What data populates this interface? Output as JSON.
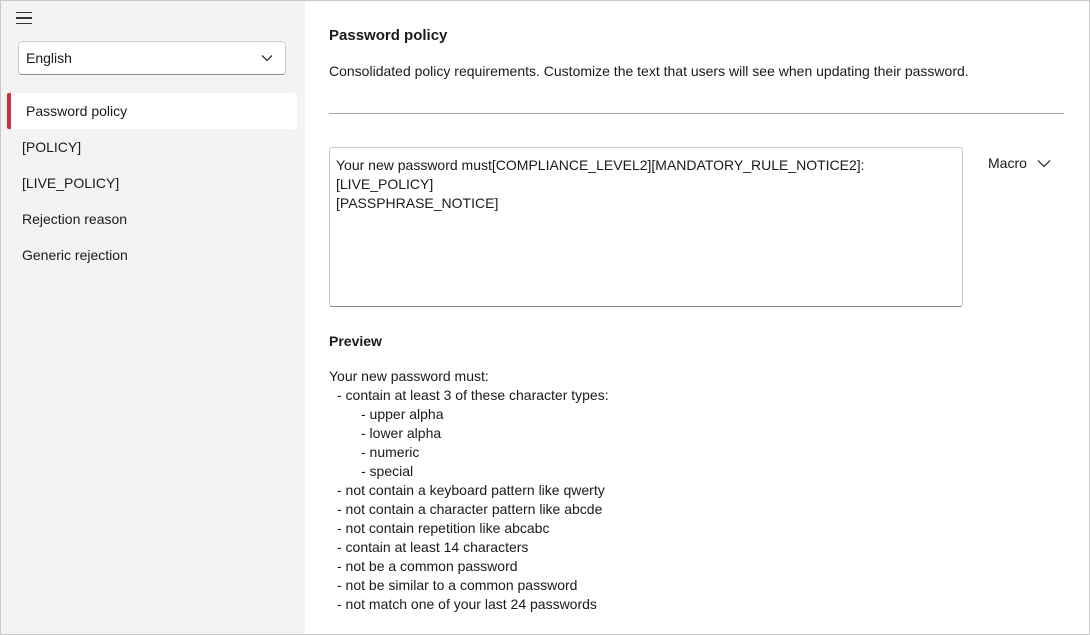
{
  "sidebar": {
    "language": "English",
    "items": [
      {
        "label": "Password policy",
        "active": true
      },
      {
        "label": "[POLICY]",
        "active": false
      },
      {
        "label": "[LIVE_POLICY]",
        "active": false
      },
      {
        "label": "Rejection reason",
        "active": false
      },
      {
        "label": "Generic rejection",
        "active": false
      }
    ]
  },
  "main": {
    "title": "Password policy",
    "description": "Consolidated policy requirements. Customize the text that users will see when updating their password.",
    "editor_value": "Your new password must[COMPLIANCE_LEVEL2][MANDATORY_RULE_NOTICE2]:\n[LIVE_POLICY]\n[PASSPHRASE_NOTICE]",
    "macro_label": "Macro",
    "preview_title": "Preview",
    "preview_lines": [
      {
        "text": "Your new password must:",
        "level": 0
      },
      {
        "text": "- contain at least 3 of these character types:",
        "level": 1
      },
      {
        "text": "- upper alpha",
        "level": 2
      },
      {
        "text": "- lower alpha",
        "level": 2
      },
      {
        "text": "- numeric",
        "level": 2
      },
      {
        "text": "- special",
        "level": 2
      },
      {
        "text": "- not contain a keyboard pattern like qwerty",
        "level": 1
      },
      {
        "text": "- not contain a character pattern like abcde",
        "level": 1
      },
      {
        "text": "- not contain repetition like abcabc",
        "level": 1
      },
      {
        "text": "- contain at least 14 characters",
        "level": 1
      },
      {
        "text": "- not be a common password",
        "level": 1
      },
      {
        "text": "- not be similar to a common password",
        "level": 1
      },
      {
        "text": "- not match one of your last 24 passwords",
        "level": 1
      }
    ]
  },
  "colors": {
    "accent": "#d32f3c",
    "sidebar_bg": "#f3f3f3"
  }
}
